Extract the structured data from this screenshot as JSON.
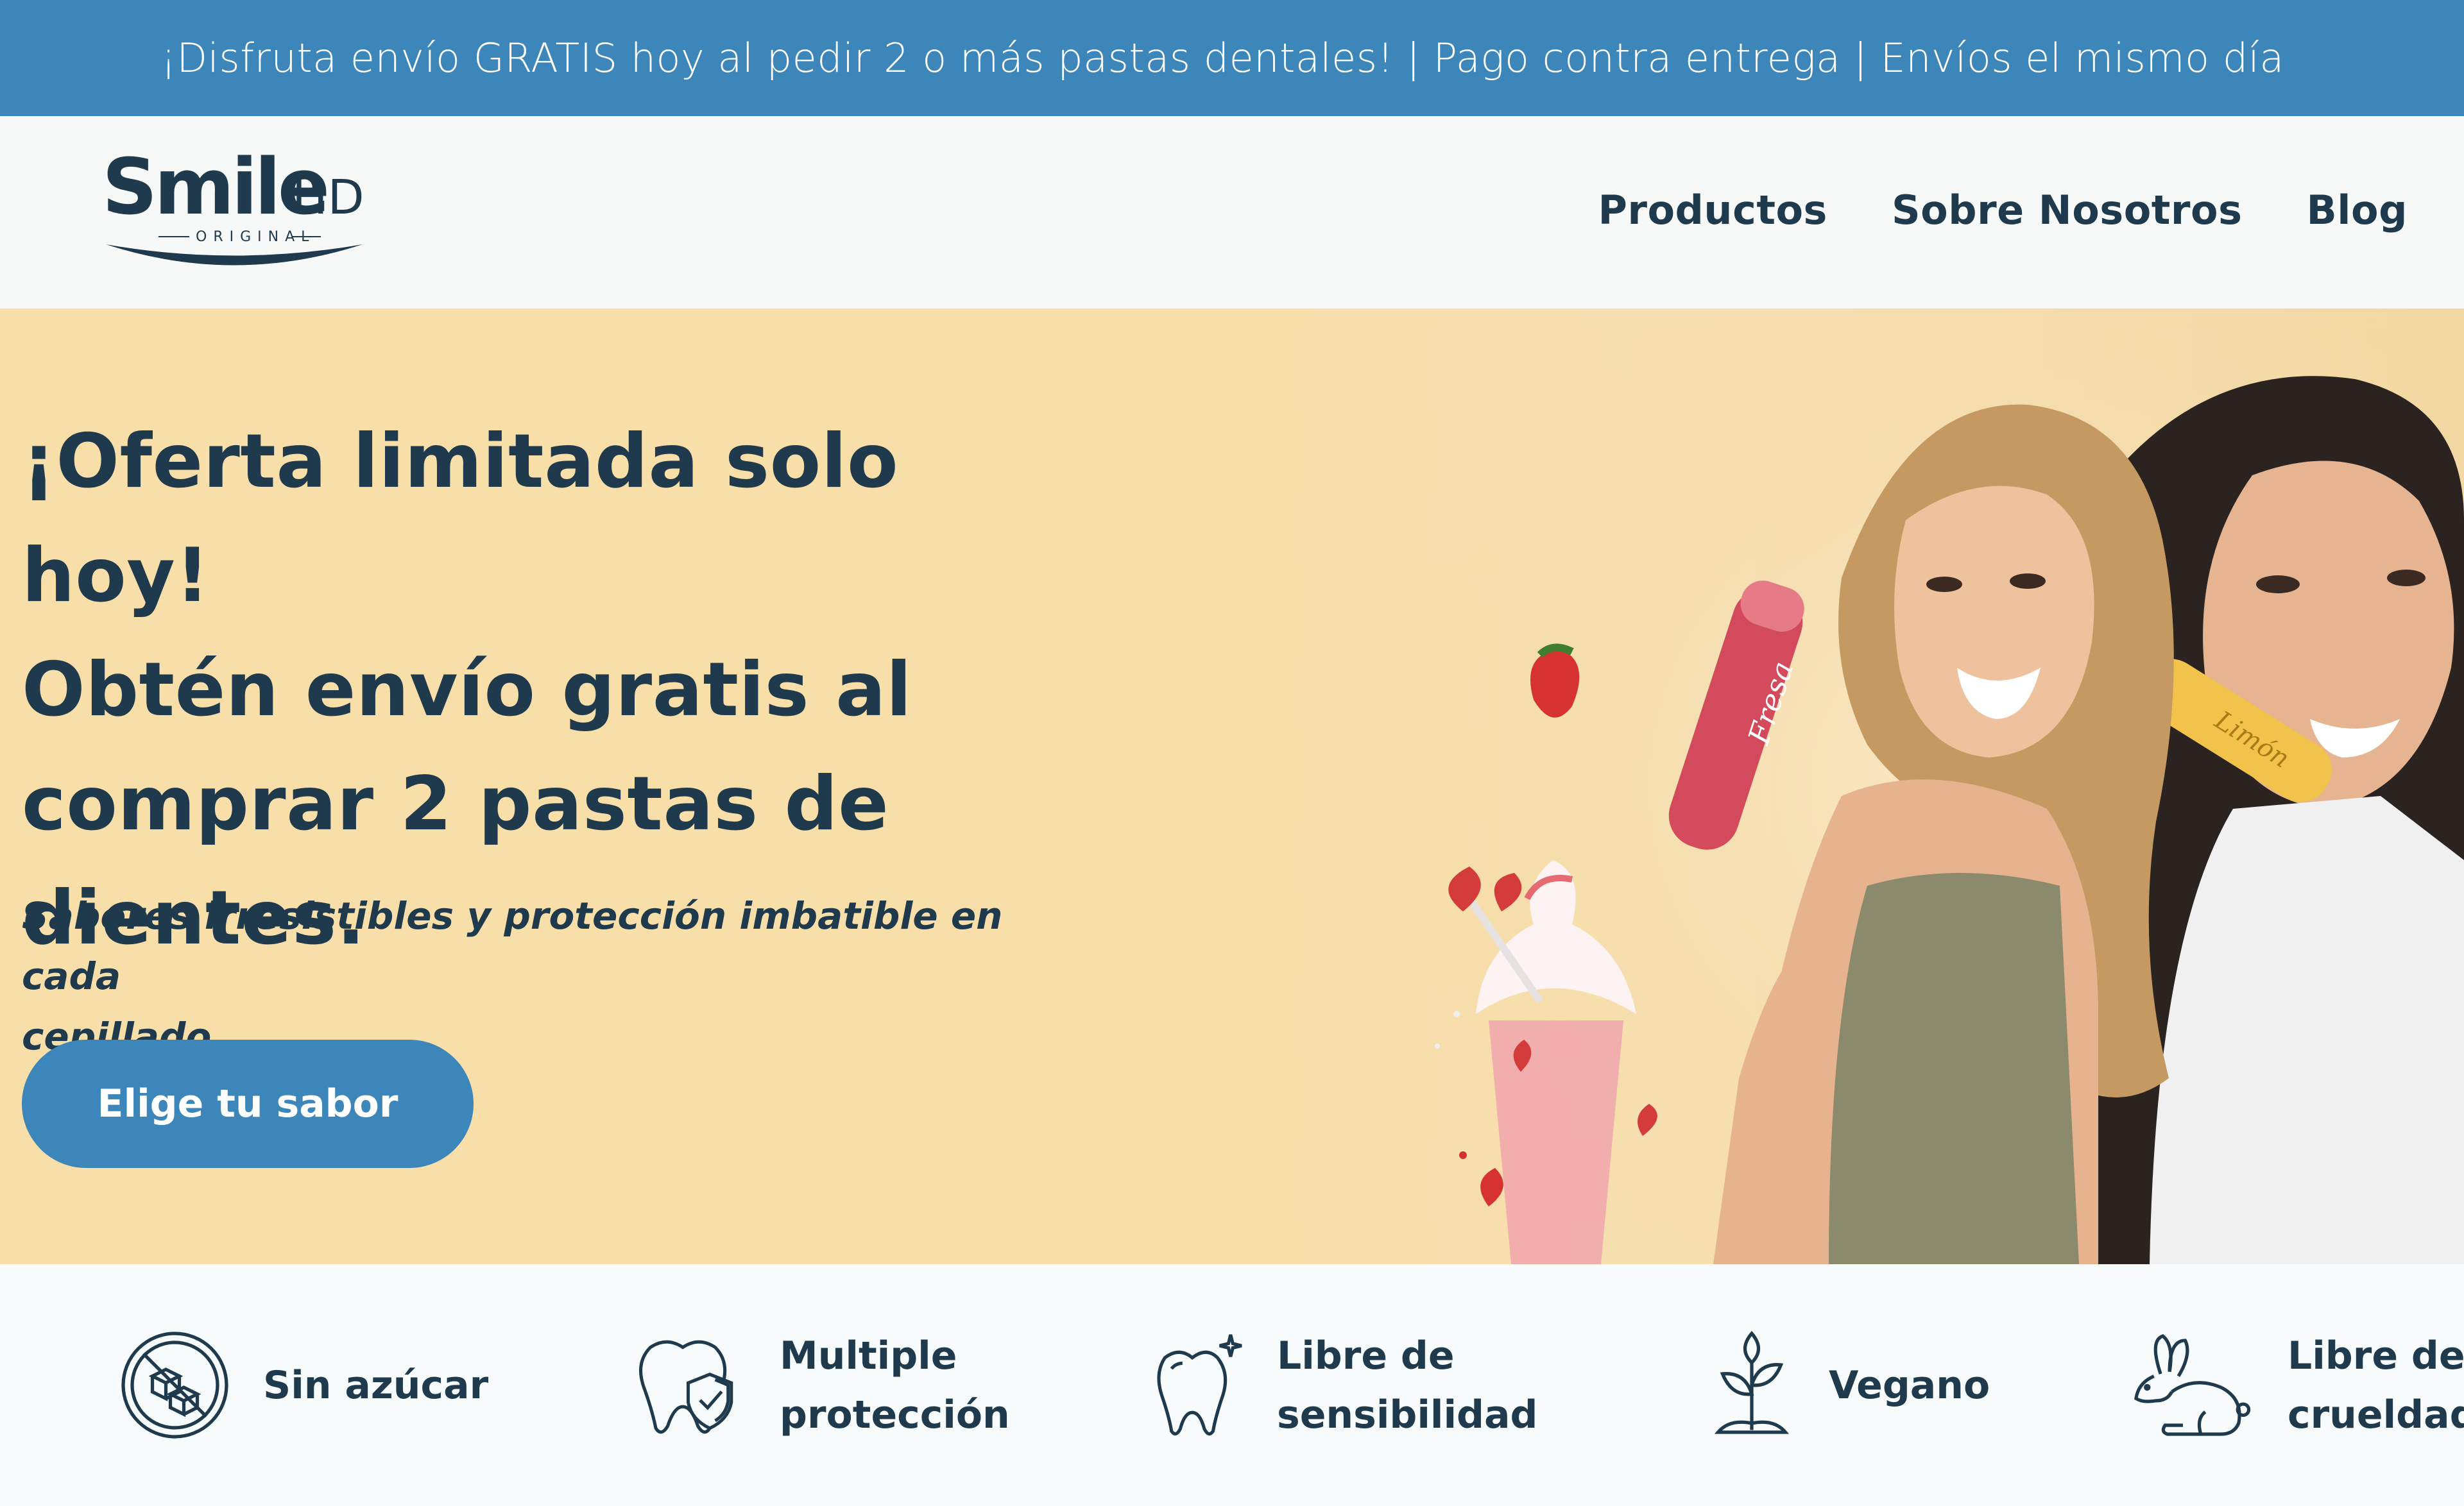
{
  "announcement": "¡Disfruta envío GRATIS hoy al pedir 2 o más pastas dentales! | Pago contra entrega | Envíos el mismo día",
  "logo": {
    "brand": "Smile",
    "suffix": "HD",
    "tagline": "ORIGINAL"
  },
  "nav": {
    "items": [
      "Productos",
      "Sobre Nosotros",
      "Blog"
    ]
  },
  "hero": {
    "title_lines": [
      "¡Oferta limitada solo hoy!",
      "Obtén envío gratis al",
      "comprar 2 pastas de",
      "dientes."
    ],
    "subtitle_lines": [
      "Sabores irresistibles y protección imbatible en cada",
      "cepillado."
    ],
    "cta_label": "Elige tu sabor",
    "product_labels": [
      "Fresa",
      "Limón"
    ]
  },
  "features": [
    {
      "icon": "no-sugar-icon",
      "lines": [
        "Sin azúcar"
      ]
    },
    {
      "icon": "tooth-shield-icon",
      "lines": [
        "Multiple",
        "protección"
      ]
    },
    {
      "icon": "tooth-sparkle-icon",
      "lines": [
        "Libre de",
        "sensibilidad"
      ]
    },
    {
      "icon": "plant-icon",
      "lines": [
        "Vegano"
      ]
    },
    {
      "icon": "rabbit-icon",
      "lines": [
        "Libre de",
        "crueldad"
      ]
    }
  ],
  "colors": {
    "announcement_bg": "#3d86b9",
    "primary_text": "#1f3a4d",
    "hero_bg": "#f8dea9",
    "cta_bg": "#3d86b9",
    "header_bg": "#f7f8f8"
  }
}
